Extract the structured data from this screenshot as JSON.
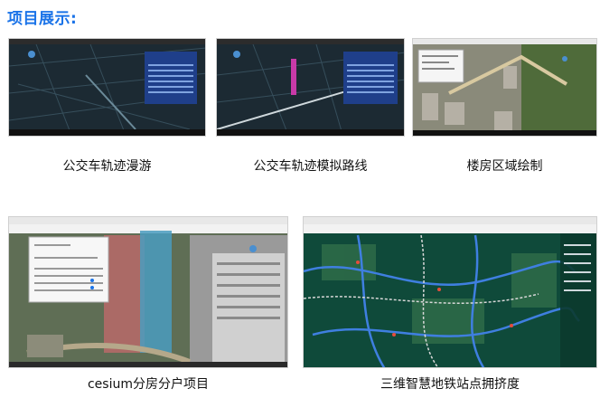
{
  "heading": "项目展示:",
  "projects": [
    {
      "caption": "公交车轨迹漫游"
    },
    {
      "caption": "公交车轨迹模拟路线"
    },
    {
      "caption": "楼房区域绘制"
    },
    {
      "caption": "cesium分房分户项目"
    },
    {
      "caption": "三维智慧地铁站点拥挤度"
    }
  ],
  "colors": {
    "heading": "#1a73e8",
    "dark_map": "#1c2a33",
    "panel_blue": "#1f3f8a",
    "metro_bg": "#0f4a3a"
  }
}
